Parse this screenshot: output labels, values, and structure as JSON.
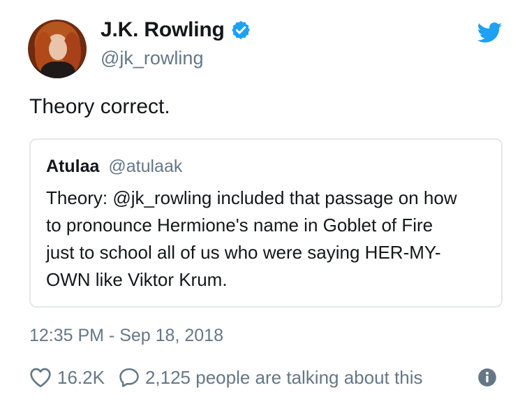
{
  "tweet": {
    "author": {
      "display_name": "J.K. Rowling",
      "handle": "@jk_rowling",
      "verified": true,
      "avatar": "profile-photo"
    },
    "text": "Theory correct.",
    "quoted_tweet": {
      "author_name": "Atulaa",
      "author_handle": "@atulaak",
      "lines": [
        "Theory: @jk_rowling included that passage on how",
        "to pronounce Hermione's name in Goblet of Fire",
        "just to school all of us who were saying HER-MY-",
        "OWN like Viktor Krum."
      ]
    },
    "timestamp": "12:35 PM - Sep 18, 2018",
    "likes": "16.2K",
    "talking": "2,125 people are talking about this"
  },
  "icons": {
    "brand": "twitter-bird-icon",
    "verified": "verified-badge-icon",
    "like": "heart-icon",
    "reply": "speech-bubble-icon",
    "info": "info-icon"
  },
  "colors": {
    "twitter_blue": "#1da1f2",
    "text_primary": "#14171a",
    "text_secondary": "#657786",
    "border": "#e1e8ed"
  }
}
